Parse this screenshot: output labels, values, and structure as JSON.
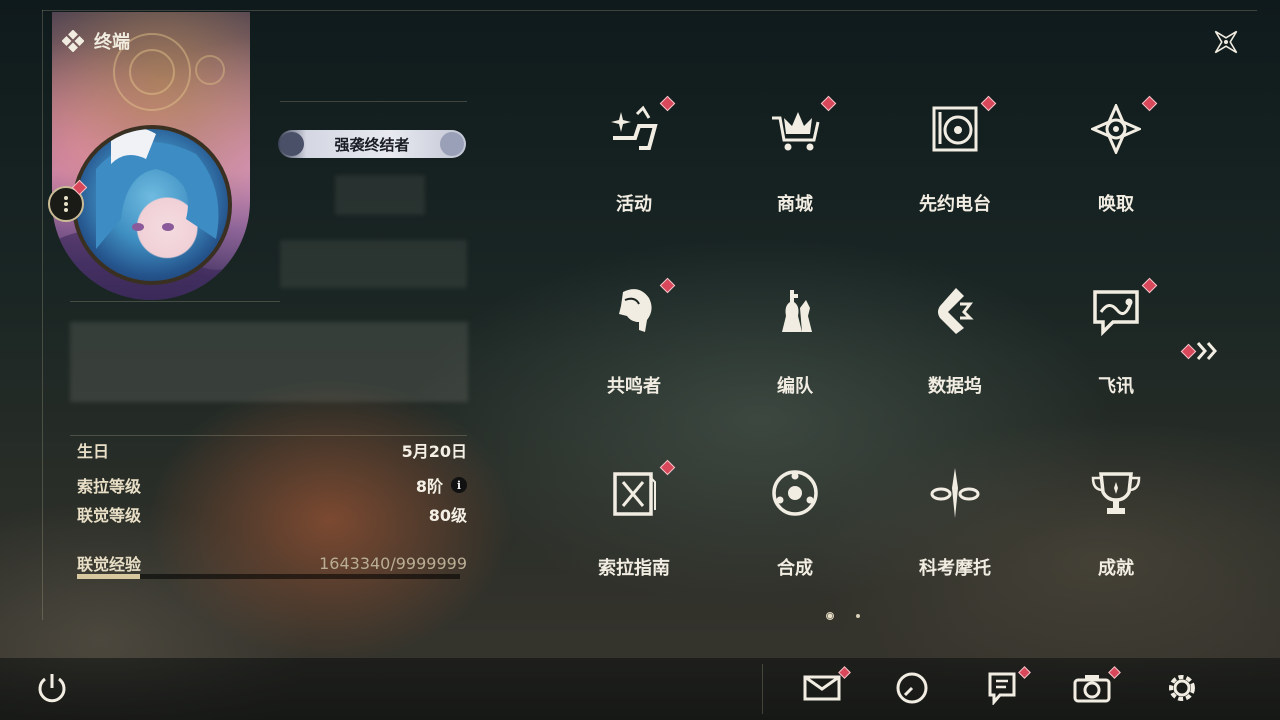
{
  "header": {
    "title": "终端"
  },
  "profile": {
    "title_chip": "强袭终结者",
    "stats": [
      {
        "label": "生日",
        "value": "5月20日"
      },
      {
        "label": "索拉等级",
        "value": "8阶"
      },
      {
        "label": "联觉等级",
        "value": "80级"
      }
    ],
    "xp": {
      "label": "联觉经验",
      "value": "1643340/9999999",
      "fill": 0.164
    }
  },
  "menu": [
    {
      "label": "活动",
      "icon": "sparkle-icon",
      "badge": true
    },
    {
      "label": "商城",
      "icon": "cart-crown-icon",
      "badge": true
    },
    {
      "label": "先约电台",
      "icon": "turntable-icon",
      "badge": true
    },
    {
      "label": "唤取",
      "icon": "compass-star-icon",
      "badge": true
    },
    {
      "label": "共鸣者",
      "icon": "character-head-icon",
      "badge": true
    },
    {
      "label": "编队",
      "icon": "chess-pieces-icon",
      "badge": false
    },
    {
      "label": "数据坞",
      "icon": "data-dock-icon",
      "badge": false
    },
    {
      "label": "飞讯",
      "icon": "chat-bubble-icon",
      "badge": true
    },
    {
      "label": "索拉指南",
      "icon": "guide-book-icon",
      "badge": true
    },
    {
      "label": "合成",
      "icon": "synthesis-icon",
      "badge": false
    },
    {
      "label": "科考摩托",
      "icon": "motorcycle-icon",
      "badge": false
    },
    {
      "label": "成就",
      "icon": "trophy-icon",
      "badge": false
    }
  ],
  "pagination": {
    "current": 1,
    "total": 2
  },
  "colors": {
    "badge": "#d8475a",
    "text": "#f2ede2",
    "accent": "#d8c8a0"
  }
}
